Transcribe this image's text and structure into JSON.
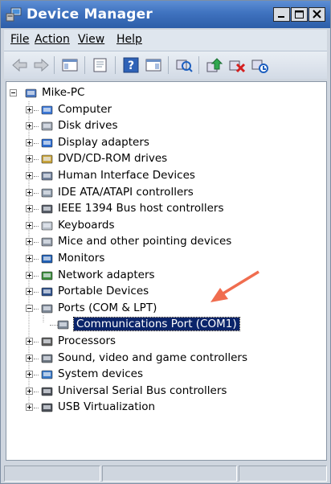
{
  "window": {
    "title": "Device Manager",
    "accent_color": "#3f72bf"
  },
  "menubar": {
    "items": [
      {
        "label": "File"
      },
      {
        "label": "Action"
      },
      {
        "label": "View"
      },
      {
        "label": "Help"
      }
    ]
  },
  "toolbar": {
    "buttons": [
      "back-icon",
      "forward-icon",
      "show-hide-console-tree-icon",
      "properties-icon",
      "help-icon",
      "action-pane-icon",
      "scan-hardware-changes-icon",
      "update-driver-icon",
      "uninstall-icon",
      "enable-disable-icon"
    ]
  },
  "tree": {
    "root": {
      "label": "Mike-PC",
      "icon": "computer-network-icon"
    },
    "categories": [
      {
        "label": "Computer",
        "icon": "computer-icon",
        "expanded": false
      },
      {
        "label": "Disk drives",
        "icon": "disk-drive-icon",
        "expanded": false
      },
      {
        "label": "Display adapters",
        "icon": "display-adapter-icon",
        "expanded": false
      },
      {
        "label": "DVD/CD-ROM drives",
        "icon": "dvd-drive-icon",
        "expanded": false
      },
      {
        "label": "Human Interface Devices",
        "icon": "hid-icon",
        "expanded": false
      },
      {
        "label": "IDE ATA/ATAPI controllers",
        "icon": "ide-controller-icon",
        "expanded": false
      },
      {
        "label": "IEEE 1394 Bus host controllers",
        "icon": "ieee1394-icon",
        "expanded": false
      },
      {
        "label": "Keyboards",
        "icon": "keyboard-icon",
        "expanded": false
      },
      {
        "label": "Mice and other pointing devices",
        "icon": "mouse-icon",
        "expanded": false
      },
      {
        "label": "Monitors",
        "icon": "monitor-icon",
        "expanded": false
      },
      {
        "label": "Network adapters",
        "icon": "network-adapter-icon",
        "expanded": false
      },
      {
        "label": "Portable Devices",
        "icon": "portable-device-icon",
        "expanded": false
      },
      {
        "label": "Ports (COM & LPT)",
        "icon": "port-icon",
        "expanded": true,
        "children": [
          {
            "label": "Communications Port (COM1)",
            "icon": "port-icon",
            "selected": true
          }
        ]
      },
      {
        "label": "Processors",
        "icon": "processor-icon",
        "expanded": false
      },
      {
        "label": "Sound, video and game controllers",
        "icon": "sound-icon",
        "expanded": false
      },
      {
        "label": "System devices",
        "icon": "system-device-icon",
        "expanded": false
      },
      {
        "label": "Universal Serial Bus controllers",
        "icon": "usb-icon",
        "expanded": false
      },
      {
        "label": "USB Virtualization",
        "icon": "usb-icon",
        "expanded": false
      }
    ]
  },
  "annotation": {
    "arrow_color": "#f06d4f"
  }
}
